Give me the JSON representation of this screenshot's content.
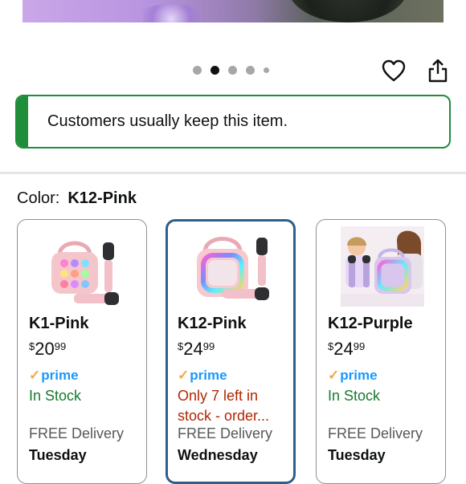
{
  "gallery": {
    "dots": [
      "inactive",
      "active",
      "inactive",
      "inactive",
      "small"
    ]
  },
  "actions": {
    "favorite_icon": "heart-icon",
    "share_icon": "share-icon"
  },
  "notice": {
    "text": "Customers usually keep this item.",
    "accent_color": "#1f8d3a"
  },
  "color_selector": {
    "label": "Color:",
    "selected": "K12-Pink",
    "options": [
      {
        "name": "K1-Pink",
        "price_symbol": "$",
        "price_whole": "20",
        "price_fraction": "99",
        "prime": "prime",
        "stock": "In Stock",
        "delivery": "FREE Delivery",
        "day": "Tuesday"
      },
      {
        "name": "K12-Pink",
        "price_symbol": "$",
        "price_whole": "24",
        "price_fraction": "99",
        "prime": "prime",
        "stock": "Only 7 left in stock - order...",
        "delivery": "FREE Delivery",
        "day": "Wednesday"
      },
      {
        "name": "K12-Purple",
        "price_symbol": "$",
        "price_whole": "24",
        "price_fraction": "99",
        "prime": "prime",
        "stock": "In Stock",
        "delivery": "FREE Delivery",
        "day": "Tuesday"
      }
    ]
  },
  "colors": {
    "selected_border": "#2d5f8a",
    "in_stock": "#157a2e",
    "low_stock": "#b12704",
    "prime_blue": "#1a98ff"
  }
}
